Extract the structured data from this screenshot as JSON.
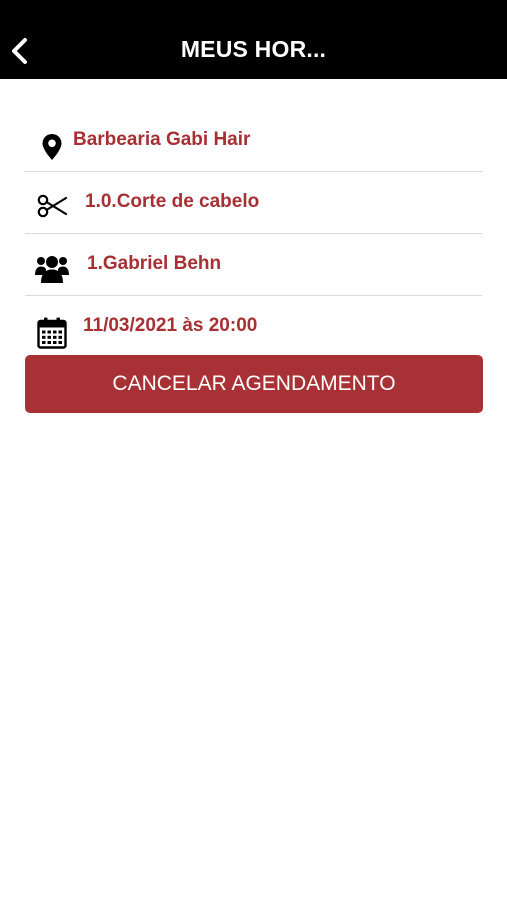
{
  "header": {
    "title": "MEUS HOR...",
    "back_icon": "chevron-left-icon"
  },
  "appointment": {
    "location": {
      "icon": "map-pin-icon",
      "text": "Barbearia Gabi Hair"
    },
    "service": {
      "icon": "scissors-icon",
      "text": "1.0.Corte de cabelo"
    },
    "professional": {
      "icon": "users-icon",
      "text": "1.Gabriel Behn"
    },
    "datetime": {
      "icon": "calendar-icon",
      "text": "11/03/2021 às 20:00"
    }
  },
  "actions": {
    "cancel_label": "CANCELAR AGENDAMENTO"
  },
  "colors": {
    "header_bg": "#000000",
    "accent": "#a83135",
    "text_accent": "#a63034"
  }
}
